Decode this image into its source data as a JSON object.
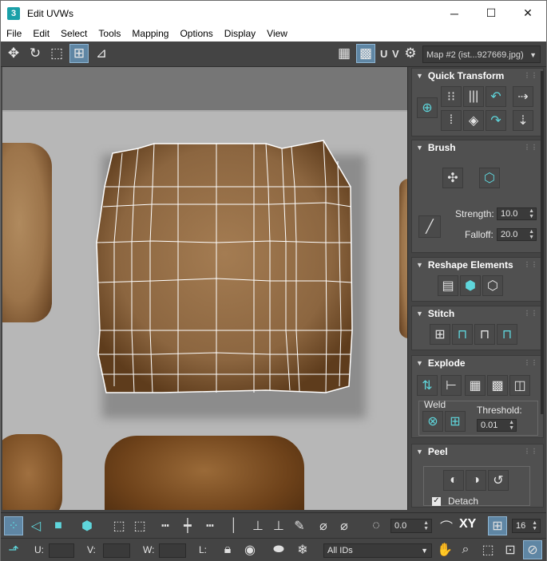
{
  "window": {
    "title": "Edit UVWs",
    "app_icon": "3",
    "controls": {
      "minimize": "─",
      "maximize": "☐",
      "close": "✕"
    }
  },
  "menu": [
    "File",
    "Edit",
    "Select",
    "Tools",
    "Mapping",
    "Options",
    "Display",
    "View"
  ],
  "top_toolbar": {
    "uv_label": "U V",
    "map_dropdown": "Map #2 (ist...927669.jpg)"
  },
  "panel": {
    "quick_transform": {
      "title": "Quick Transform"
    },
    "brush": {
      "title": "Brush",
      "strength_label": "Strength:",
      "strength_value": "10.0",
      "falloff_label": "Falloff:",
      "falloff_value": "20.0"
    },
    "reshape": {
      "title": "Reshape Elements"
    },
    "stitch": {
      "title": "Stitch"
    },
    "explode": {
      "title": "Explode",
      "weld_label": "Weld",
      "threshold_label": "Threshold:",
      "threshold_value": "0.01"
    },
    "peel": {
      "title": "Peel",
      "detach_label": "Detach"
    }
  },
  "bottom_toolbar": {
    "rotation_value": "0.0",
    "xy_label": "XY",
    "grid_value": "16"
  },
  "status_bar": {
    "u_label": "U:",
    "v_label": "V:",
    "w_label": "W:",
    "l_label": "L:",
    "ids_dropdown": "All IDs"
  },
  "colors": {
    "accent": "#5fd6dc",
    "active_button": "#5f86a4",
    "ui_background": "#444444",
    "viewport_background": "#b7b7b7"
  }
}
